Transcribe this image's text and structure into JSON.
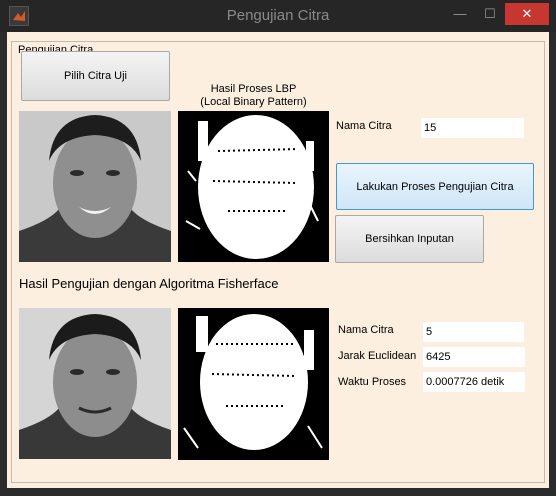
{
  "window": {
    "title": "Pengujian Citra",
    "min_glyph": "—",
    "max_glyph": "☐",
    "close_glyph": "✕",
    "close_color": "#c7372f"
  },
  "panel": {
    "title": "Pengujian Citra"
  },
  "buttons": {
    "pilih": "Pilih Citra Uji",
    "proses": "Lakukan Proses Pengujian Citra",
    "bersihkan": "Bersihkan Inputan"
  },
  "lbp_caption": {
    "line1": "Hasil Proses LBP",
    "line2": "(Local Binary Pattern)"
  },
  "test": {
    "nama_label": "Nama Citra",
    "nama_value": "15"
  },
  "result_heading": "Hasil Pengujian dengan Algoritma Fisherface",
  "result": {
    "nama_label": "Nama Citra",
    "nama_value": "5",
    "jarak_label": "Jarak Euclidean",
    "jarak_value": "6425",
    "waktu_label": "Waktu Proses",
    "waktu_value": "0.0007726 detik"
  }
}
